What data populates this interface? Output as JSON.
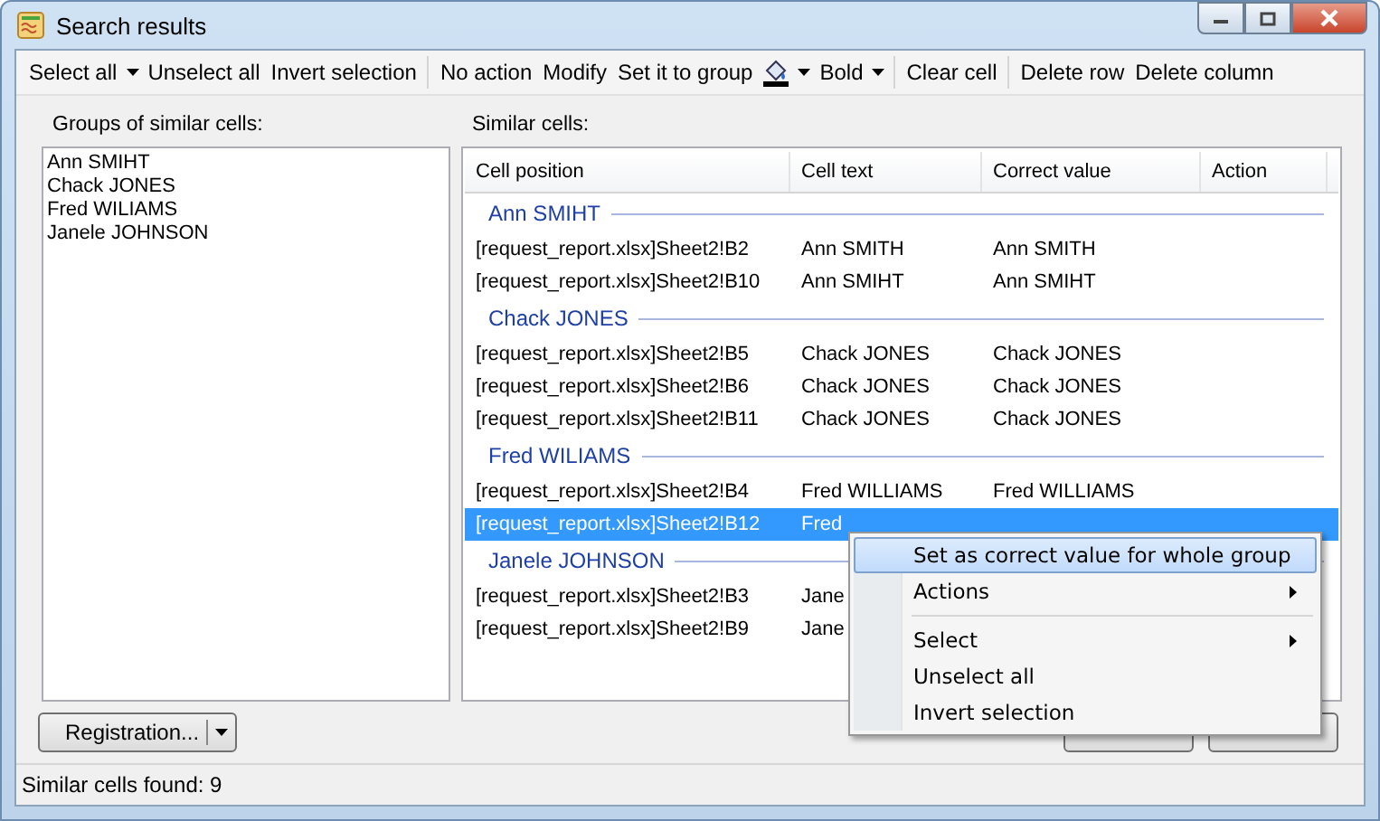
{
  "window": {
    "title": "Search results"
  },
  "toolbar": [
    {
      "kind": "split",
      "label": "Select all"
    },
    {
      "kind": "button",
      "label": "Unselect all"
    },
    {
      "kind": "button",
      "label": "Invert selection"
    },
    {
      "kind": "separator"
    },
    {
      "kind": "button",
      "label": "No action"
    },
    {
      "kind": "button",
      "label": "Modify"
    },
    {
      "kind": "button",
      "label": "Set it to group"
    },
    {
      "kind": "fill-split"
    },
    {
      "kind": "split",
      "label": "Bold"
    },
    {
      "kind": "separator"
    },
    {
      "kind": "button",
      "label": "Clear cell"
    },
    {
      "kind": "separator"
    },
    {
      "kind": "button",
      "label": "Delete row"
    },
    {
      "kind": "button",
      "label": "Delete column"
    }
  ],
  "groups_panel": {
    "label": "Groups of similar cells:",
    "items": [
      "Ann SMIHT",
      "Chack JONES",
      "Fred WILIAMS",
      "Janele JOHNSON"
    ]
  },
  "similar_panel": {
    "label": "Similar cells:",
    "columns": [
      "Cell position",
      "Cell text",
      "Correct value",
      "Action"
    ],
    "groups": [
      {
        "name": "Ann SMIHT",
        "rows": [
          {
            "position": "[request_report.xlsx]Sheet2!B2",
            "text": "Ann SMITH",
            "correct": "Ann SMITH",
            "selected": false
          },
          {
            "position": "[request_report.xlsx]Sheet2!B10",
            "text": "Ann SMIHT",
            "correct": "Ann SMIHT",
            "selected": false
          }
        ]
      },
      {
        "name": "Chack JONES",
        "rows": [
          {
            "position": "[request_report.xlsx]Sheet2!B5",
            "text": "Chack JONES",
            "correct": "Chack JONES",
            "selected": false
          },
          {
            "position": "[request_report.xlsx]Sheet2!B6",
            "text": "Chack JONES",
            "correct": "Chack JONES",
            "selected": false
          },
          {
            "position": "[request_report.xlsx]Sheet2!B11",
            "text": "Chack JONES",
            "correct": "Chack JONES",
            "selected": false
          }
        ]
      },
      {
        "name": "Fred WILIAMS",
        "rows": [
          {
            "position": "[request_report.xlsx]Sheet2!B4",
            "text": "Fred WILLIAMS",
            "correct": "Fred WILLIAMS",
            "selected": false
          },
          {
            "position": "[request_report.xlsx]Sheet2!B12",
            "text": "Fred",
            "selected": true
          }
        ]
      },
      {
        "name": "Janele JOHNSON",
        "rows": [
          {
            "position": "[request_report.xlsx]Sheet2!B3",
            "text": "Jane",
            "selected": false
          },
          {
            "position": "[request_report.xlsx]Sheet2!B9",
            "text": "Jane",
            "selected": false
          }
        ]
      }
    ]
  },
  "registration_button": {
    "label": "Registration..."
  },
  "status_bar": {
    "text": "Similar cells found: 9"
  },
  "context_menu": [
    {
      "kind": "item",
      "label": "Set as correct value for whole group",
      "highlighted": true,
      "submenu": false
    },
    {
      "kind": "item",
      "label": "Actions",
      "highlighted": false,
      "submenu": true
    },
    {
      "kind": "separator"
    },
    {
      "kind": "item",
      "label": "Select",
      "highlighted": false,
      "submenu": true
    },
    {
      "kind": "item",
      "label": "Unselect all",
      "highlighted": false,
      "submenu": false
    },
    {
      "kind": "item",
      "label": "Invert selection",
      "highlighted": false,
      "submenu": false
    }
  ]
}
